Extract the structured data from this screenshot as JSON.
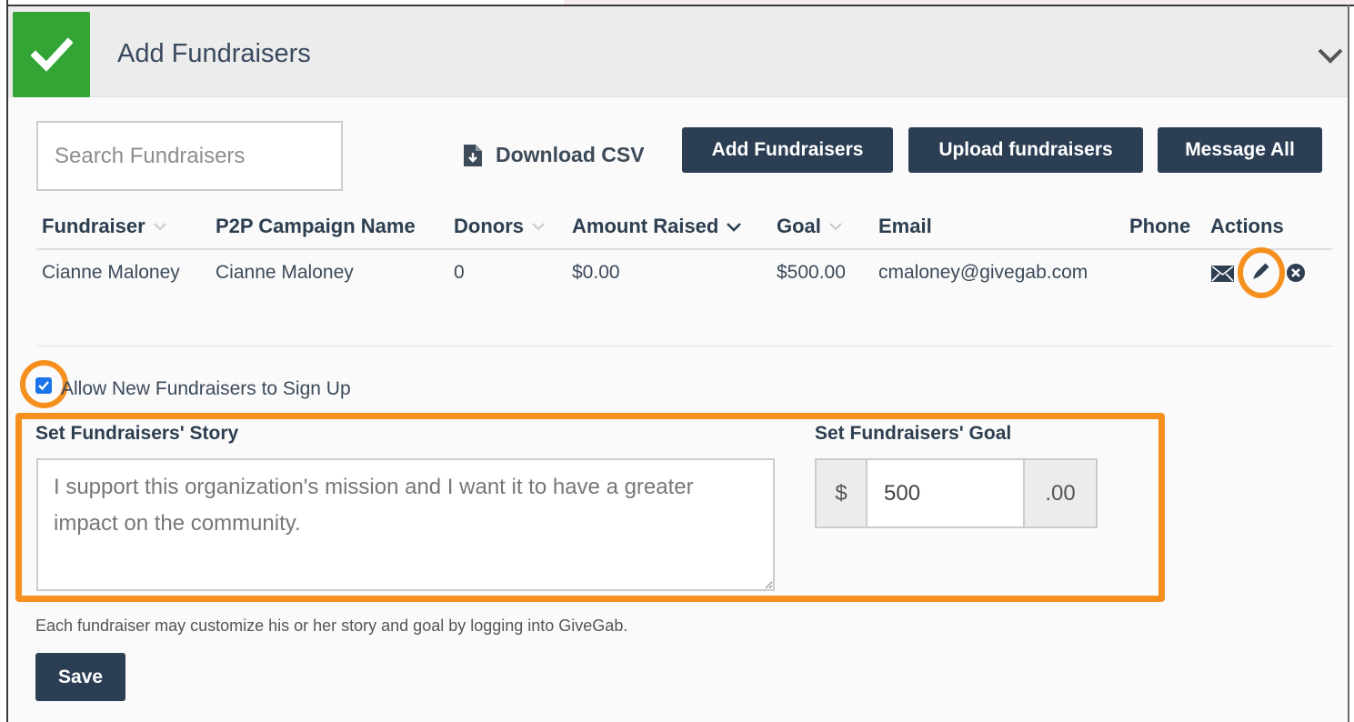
{
  "header": {
    "title": "Add Fundraisers"
  },
  "toolbar": {
    "search_placeholder": "Search Fundraisers",
    "download_label": "Download CSV",
    "add_label": "Add Fundraisers",
    "upload_label": "Upload fundraisers",
    "message_label": "Message All"
  },
  "table": {
    "columns": [
      "Fundraiser",
      "P2P Campaign Name",
      "Donors",
      "Amount Raised",
      "Goal",
      "Email",
      "Phone",
      "Actions"
    ],
    "rows": [
      {
        "fundraiser": "Cianne Maloney",
        "campaign": "Cianne Maloney",
        "donors": "0",
        "amount": "$0.00",
        "goal": "$500.00",
        "email": "cmaloney@givegab.com",
        "phone": ""
      }
    ]
  },
  "signup": {
    "label": "Allow New Fundraisers to Sign Up",
    "checked": true
  },
  "story": {
    "label": "Set Fundraisers' Story",
    "value": "I support this organization's mission and I want it to have a greater impact on the community."
  },
  "goal": {
    "label": "Set Fundraisers' Goal",
    "prefix": "$",
    "value": "500",
    "suffix": ".00"
  },
  "help_text": "Each fundraiser may customize his or her story and goal by logging into GiveGab.",
  "save_label": "Save",
  "colors": {
    "primary": "#2c3e54",
    "success": "#32a534",
    "highlight": "#f5901e"
  }
}
